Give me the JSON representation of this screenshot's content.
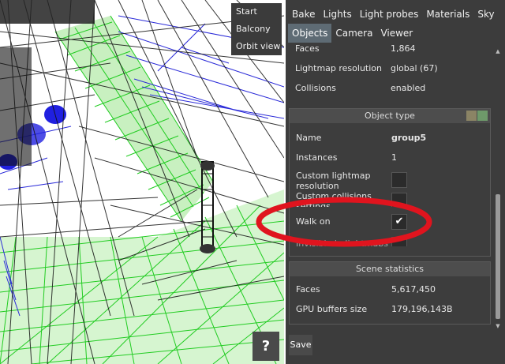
{
  "viewport": {
    "menu": [
      "Start",
      "Balcony",
      "Orbit view"
    ],
    "help_label": "?"
  },
  "tabs_row1": [
    "Bake",
    "Lights",
    "Light probes",
    "Materials",
    "Sky"
  ],
  "tabs_row2": [
    "Objects",
    "Camera",
    "Viewer"
  ],
  "active_tab": "Objects",
  "object_props": [
    {
      "key": "Faces",
      "value": "1,864"
    },
    {
      "key": "Lightmap resolution",
      "value": "global (67)"
    },
    {
      "key": "Collisions",
      "value": "enabled"
    }
  ],
  "object_type": {
    "title": "Object type",
    "name_label": "Name",
    "name_value": "group5",
    "instances_label": "Instances",
    "instances_value": "1",
    "custom_lightmap_label": "Custom lightmap resolution",
    "custom_collisions_label": "Custom collisions settings",
    "walk_on_label": "Walk on",
    "walk_on_checked": "✔",
    "hidden_row_label": "Invisible in lightmaps",
    "swatch_colors": [
      "#8b8465",
      "#6e9a6a"
    ]
  },
  "scene_statistics": {
    "title": "Scene statistics",
    "rows": [
      {
        "key": "Faces",
        "value": "5,617,450"
      },
      {
        "key": "GPU buffers size",
        "value": "179,196,143B"
      }
    ]
  },
  "save_label": "Save",
  "colors": {
    "panel_bg": "#3c3c3c",
    "active_tab": "#5e6b74",
    "annotation": "#e0141e",
    "wire_green": "#1fcc1f",
    "wire_blue": "#2a2ad8"
  }
}
